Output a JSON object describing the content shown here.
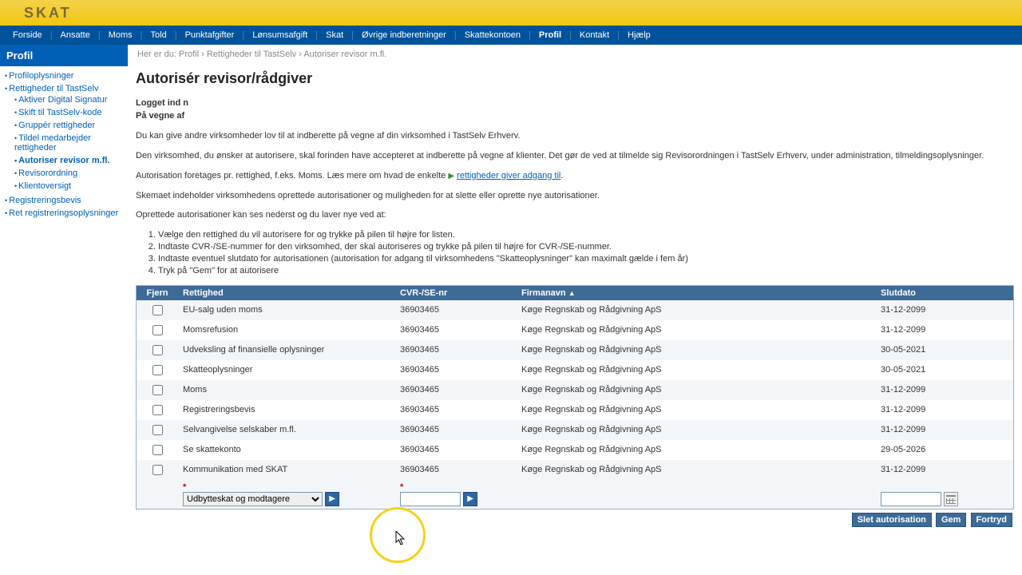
{
  "logo": "SKAT",
  "topnav": [
    "Forside",
    "Ansatte",
    "Moms",
    "Told",
    "Punktafgifter",
    "Lønsumsafgift",
    "Skat",
    "Øvrige indberetninger",
    "Skattekontoen",
    "Profil",
    "Kontakt",
    "Hjælp"
  ],
  "topnav_active": 9,
  "sidehead": "Profil",
  "sidenav": {
    "items": [
      {
        "label": "Profiloplysninger"
      },
      {
        "label": "Rettigheder til TastSelv",
        "children": [
          {
            "label": "Aktiver Digital Signatur"
          },
          {
            "label": "Skift til TastSelv-kode"
          },
          {
            "label": "Gruppér rettigheder"
          },
          {
            "label": "Tildel medarbejder rettigheder"
          },
          {
            "label": "Autoriser revisor m.fl.",
            "active": true
          },
          {
            "label": "Revisorordning"
          },
          {
            "label": "Klientoversigt"
          }
        ]
      },
      {
        "label": "Registreringsbevis"
      },
      {
        "label": "Ret registreringsoplysninger"
      }
    ]
  },
  "crumbs": {
    "prefix": "Her er du:",
    "path": [
      "Profil",
      "Rettigheder til TastSelv",
      "Autoriser revisor m.fl."
    ]
  },
  "h1": "Autorisér revisor/rådgiver",
  "meta": {
    "logged_label": "Logget ind n",
    "behalf_label": "På vegne af"
  },
  "paras": {
    "p1": "Du kan give andre virksomheder lov til at indberette på vegne af din virksomhed i TastSelv Erhverv.",
    "p2": "Den virksomhed, du ønsker at autorisere, skal forinden have accepteret at indberette på vegne af klienter. Det gør de ved at tilmelde sig Revisorordningen i TastSelv Erhverv, under administration, tilmeldingsoplysninger.",
    "p3a": "Autorisation foretages pr. rettighed, f.eks. Moms. Læs mere om hvad de enkelte ",
    "p3link": "rettigheder giver adgang til",
    "p4": "Skemaet indeholder virksomhedens oprettede autorisationer og muligheden for at slette eller oprette nye autorisationer.",
    "p5": "Oprettede autorisationer kan ses nederst og du laver nye ved at:",
    "steps": [
      "Vælge den rettighed du vil autorisere for og trykke på pilen til højre for listen.",
      "Indtaste CVR-/SE-nummer for den virksomhed, der skal autoriseres og trykke på pilen til højre for CVR-/SE-nummer.",
      "Indtaste eventuel slutdato for autorisationen (autorisation for adgang til virksomhedens \"Skatteoplysninger\" kan maximalt gælde i fem år)",
      "Tryk på \"Gem\" for at autorisere"
    ]
  },
  "table": {
    "headers": {
      "remove": "Fjern",
      "right": "Rettighed",
      "cvr": "CVR-/SE-nr",
      "company": "Firmanavn",
      "enddate": "Slutdato"
    },
    "rows": [
      {
        "right": "EU-salg uden moms",
        "cvr": "36903465",
        "company": "Køge Regnskab og Rådgivning ApS",
        "end": "31-12-2099"
      },
      {
        "right": "Momsrefusion",
        "cvr": "36903465",
        "company": "Køge Regnskab og Rådgivning ApS",
        "end": "31-12-2099"
      },
      {
        "right": "Udveksling af finansielle oplysninger",
        "cvr": "36903465",
        "company": "Køge Regnskab og Rådgivning ApS",
        "end": "30-05-2021"
      },
      {
        "right": "Skatteoplysninger",
        "cvr": "36903465",
        "company": "Køge Regnskab og Rådgivning ApS",
        "end": "30-05-2021"
      },
      {
        "right": "Moms",
        "cvr": "36903465",
        "company": "Køge Regnskab og Rådgivning ApS",
        "end": "31-12-2099"
      },
      {
        "right": "Registreringsbevis",
        "cvr": "36903465",
        "company": "Køge Regnskab og Rådgivning ApS",
        "end": "31-12-2099"
      },
      {
        "right": "Selvangivelse selskaber m.fl.",
        "cvr": "36903465",
        "company": "Køge Regnskab og Rådgivning ApS",
        "end": "31-12-2099"
      },
      {
        "right": "Se skattekonto",
        "cvr": "36903465",
        "company": "Køge Regnskab og Rådgivning ApS",
        "end": "29-05-2026"
      },
      {
        "right": "Kommunikation med SKAT",
        "cvr": "36903465",
        "company": "Køge Regnskab og Rådgivning ApS",
        "end": "31-12-2099"
      }
    ],
    "newrow": {
      "select": "Udbytteskat og modtagere"
    }
  },
  "buttons": {
    "del": "Slet autorisation",
    "save": "Gem",
    "cancel": "Fortryd"
  }
}
